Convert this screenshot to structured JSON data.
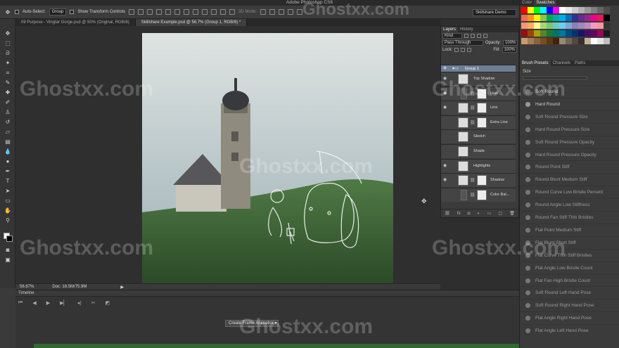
{
  "app": {
    "title": "Adobe Photoshop CS6",
    "workspace": "Skillshare Demo"
  },
  "options": {
    "auto_select_label": "Auto-Select:",
    "auto_select_value": "Group",
    "transform_label": "Show Transform Controls",
    "mode_label": "3D Mode:"
  },
  "tabs": [
    {
      "label": "09 Purpose - Vingtar Gorge.psd @ 50% (Original, RGB/8)",
      "active": false
    },
    {
      "label": "Skillshare Example.psd @ 56.7% (Group 1, RGB/8) *",
      "active": true
    }
  ],
  "status": {
    "zoom": "56.67%",
    "doc": "Doc: 18.5M/75.9M"
  },
  "timeline": {
    "title": "Timeline",
    "create_button": "Create Frame Animation"
  },
  "layers_panel": {
    "tabs": [
      "Layers",
      "History"
    ],
    "kind_label": "Kind",
    "blend_mode": "Pass Through",
    "opacity_label": "Opacity:",
    "opacity_value": "100%",
    "lock_label": "Lock:",
    "fill_label": "Fill:",
    "fill_value": "100%",
    "layers": [
      {
        "name": "Group 1",
        "type": "group",
        "visible": true
      },
      {
        "name": "Top Shadow",
        "type": "layer",
        "visible": true
      },
      {
        "name": "Hue/...",
        "type": "adjustment",
        "visible": true
      },
      {
        "name": "Line",
        "type": "masked",
        "visible": true
      },
      {
        "name": "Extra Line",
        "type": "masked",
        "visible": false
      },
      {
        "name": "Sketch",
        "type": "layer",
        "visible": false
      },
      {
        "name": "Shade",
        "type": "layer",
        "visible": false
      },
      {
        "name": "Highlights",
        "type": "layer",
        "visible": true
      },
      {
        "name": "Shadow",
        "type": "masked",
        "visible": true
      },
      {
        "name": "Color Bal...",
        "type": "adjustment",
        "visible": false
      }
    ]
  },
  "swatches_panel": {
    "tabs": [
      "Color",
      "Swatches"
    ],
    "colors": [
      "#ff0000",
      "#ffff00",
      "#00ff00",
      "#00ffff",
      "#0000ff",
      "#ff00ff",
      "#ffffff",
      "#e6e6e6",
      "#cccccc",
      "#b3b3b3",
      "#999999",
      "#808080",
      "#666666",
      "#4d4d4d",
      "#f26c4f",
      "#f7941d",
      "#fff200",
      "#8dc63f",
      "#00a651",
      "#00a99d",
      "#00aeef",
      "#0072bc",
      "#2e3192",
      "#662d91",
      "#92278f",
      "#ec008c",
      "#ed145b",
      "#000000",
      "#f69679",
      "#fbaf5d",
      "#fff799",
      "#acd373",
      "#7cc576",
      "#6ccdbf",
      "#6dcff6",
      "#7da7d8",
      "#8781bd",
      "#a187be",
      "#bd8cbf",
      "#f49ac2",
      "#f5989d",
      "#333333",
      "#9e0b0f",
      "#a0410d",
      "#aba000",
      "#598527",
      "#197b30",
      "#00746b",
      "#0076a3",
      "#004a80",
      "#003471",
      "#1b1464",
      "#440e62",
      "#630460",
      "#9e005d",
      "#1a1a1a",
      "#c69c6d",
      "#a67c52",
      "#8c6239",
      "#754c24",
      "#603913",
      "#42210b",
      "#998675",
      "#736357",
      "#534741",
      "#362f2d",
      "#c7b299",
      "#ffffff",
      "#e5e5e5",
      "#bfbfbf"
    ]
  },
  "brush_panel": {
    "tabs": [
      "Brush Presets",
      "Channels",
      "Paths"
    ],
    "size_label": "Size",
    "items": [
      "Soft Round",
      "Hard Round",
      "Soft Round Pressure Size",
      "Hard Round Pressure Size",
      "Soft Round Pressure Opacity",
      "Hard Round Pressure Opacity",
      "Round Point Stiff",
      "Round Blunt Medium Stiff",
      "Round Curve Low Bristle Percent",
      "Round Angle Low Stiffness",
      "Round Fan Stiff Thin Bristles",
      "Flat Point Medium Stiff",
      "Flat Blunt Short Stiff",
      "Flat Curve Thin Stiff Bristles",
      "Flat Angle Low Bristle Count",
      "Flat Fan High Bristle Count",
      "Soft Round Left Hand Pose",
      "Soft Round Right Hand Pose",
      "Flat Angle Right Hand Pose",
      "Flat Angle Left Hand Pose"
    ]
  },
  "watermark": "Ghostxx.com"
}
